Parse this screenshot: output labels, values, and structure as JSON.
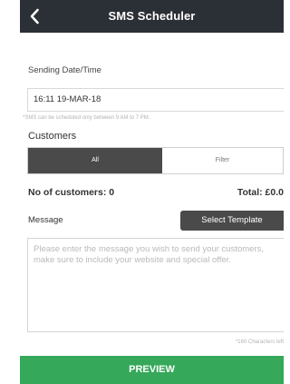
{
  "header": {
    "title": "SMS Scheduler",
    "back_icon": "chevron-left-icon"
  },
  "schedule": {
    "label": "Sending Date/Time",
    "value": "16:11 19-MAR-18",
    "hint": "*SMS can be scheduled only between 9 AM to 7 PM."
  },
  "customers": {
    "label": "Customers",
    "tabs": [
      {
        "label": "All",
        "selected": true
      },
      {
        "label": "Filter",
        "selected": false
      }
    ],
    "count_label": "No of customers: 0",
    "total_label": "Total: £0.0"
  },
  "message": {
    "label": "Message",
    "template_button": "Select Template",
    "placeholder": "Please enter the message you wish to send your customers, make sure to include your website and special offer.",
    "char_counter": "*160 Characters left"
  },
  "footer": {
    "preview_button": "PREVIEW"
  },
  "colors": {
    "header_bg": "#2b2f36",
    "segment_active_bg": "#4a4a4a",
    "preview_bg": "#35a85a"
  }
}
